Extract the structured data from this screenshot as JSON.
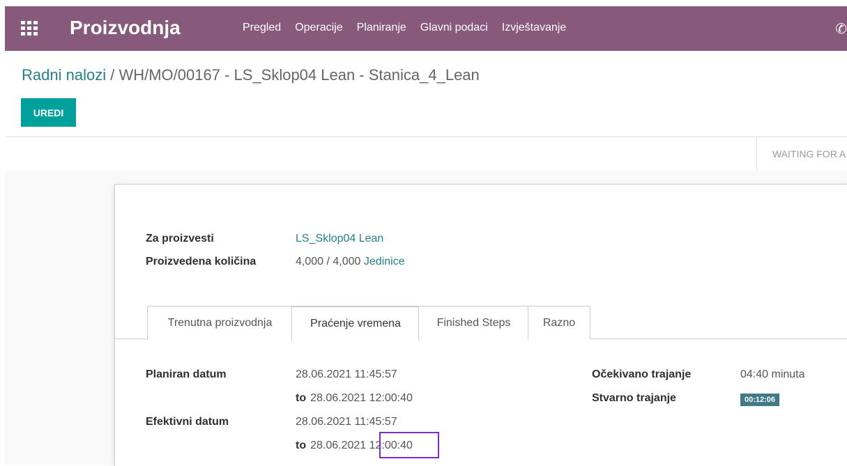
{
  "navbar": {
    "app_title": "Proizvodnja",
    "menu": [
      "Pregled",
      "Operacije",
      "Planiranje",
      "Glavni podaci",
      "Izvještavanje"
    ],
    "bg_color": "#875a7b",
    "icons": [
      "apps-grid-icon",
      "phone-icon"
    ]
  },
  "breadcrumb": {
    "parent": "Radni nalozi",
    "separator": "/",
    "current": "WH/MO/00167 - LS_Sklop04 Lean - Stanica_4_Lean"
  },
  "actions": {
    "edit_label": "UREDI"
  },
  "status": {
    "stage": "WAITING FOR A"
  },
  "form": {
    "product_label": "Za proizvesti",
    "product_value": "LS_Sklop04 Lean",
    "qty_label": "Proizvedena količina",
    "qty_produced": "4,000",
    "qty_sep": "/",
    "qty_total": "4,000",
    "qty_uom": "Jedinice"
  },
  "tabs": [
    {
      "label": "Trenutna proizvodnja",
      "active": false
    },
    {
      "label": "Praćenje vremena",
      "active": true
    },
    {
      "label": "Finished Steps",
      "active": false
    },
    {
      "label": "Razno",
      "active": false
    }
  ],
  "time_tracking": {
    "planned_label": "Planiran datum",
    "planned_start": "28.06.2021 11:45:57",
    "to_label": "to",
    "planned_end": "28.06.2021 12:00:40",
    "effective_label": "Efektivni datum",
    "effective_start": "28.06.2021 11:45:57",
    "effective_end_date": "28.06.2021",
    "effective_end_time": "12:00:40",
    "expected_label": "Očekivano trajanje",
    "expected_value": "04:40 minuta",
    "real_label": "Stvarno trajanje",
    "real_value": "00:12:06"
  }
}
